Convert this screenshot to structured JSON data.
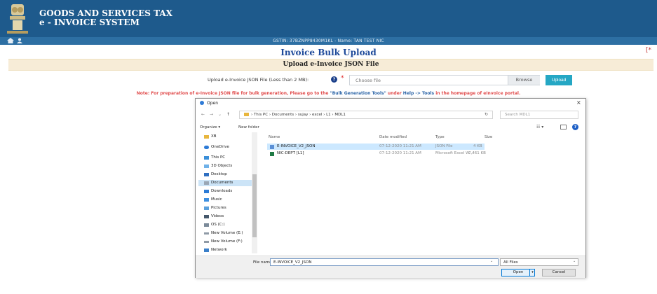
{
  "header": {
    "title_line1": "GOODS AND SERVICES TAX",
    "title_line2": "e - INVOICE SYSTEM"
  },
  "subbar": {
    "gstin_text": "GSTIN: 37BZNPP8430M1KL - Name: TAN TEST NIC"
  },
  "page": {
    "title": "Invoice Bulk Upload",
    "corner_mark": "[*",
    "section_title": "Upload e-Invoice JSON File"
  },
  "upload": {
    "label": "Upload e-Invoice JSON File (Less than 2 MB):",
    "help_glyph": "?",
    "required_mark": "*",
    "choose_placeholder": "Choose file",
    "browse_label": "Browse",
    "upload_label": "Upload"
  },
  "note": {
    "prefix": "Note: For preparation of e-Invoice JSON file for bulk generation, Please go to the ",
    "link": "\"Bulk Generation Tools\"",
    "middle": " under ",
    "help_path": "Help -> Tools",
    "suffix": " in the homepage of eInvoice portal."
  },
  "dialog": {
    "title": "Open",
    "close_glyph": "×",
    "nav_back": "←",
    "nav_forward": "→",
    "nav_recent": "⌄",
    "nav_up": "↑",
    "path": "› This PC › Documents › sujay › excel › L1 › MDL1",
    "refresh_glyph": "↻",
    "search_placeholder": "Search MDL1",
    "toolbar": {
      "organize": "Organize ▾",
      "new_folder": "New folder",
      "view_glyph": "☷ ▾",
      "help_glyph": "?"
    },
    "nav_items": [
      {
        "label": "XB"
      },
      {
        "label": "OneDrive"
      },
      {
        "label": "This PC"
      },
      {
        "label": "3D Objects"
      },
      {
        "label": "Desktop"
      },
      {
        "label": "Documents"
      },
      {
        "label": "Downloads"
      },
      {
        "label": "Music"
      },
      {
        "label": "Pictures"
      },
      {
        "label": "Videos"
      },
      {
        "label": "OS (C:)"
      },
      {
        "label": "New Volume (E:)"
      },
      {
        "label": "New Volume (F:)"
      },
      {
        "label": "Network"
      }
    ],
    "columns": {
      "name": "Name",
      "date": "Date modified",
      "type": "Type",
      "size": "Size"
    },
    "files": [
      {
        "name": "E-INVOICE_V2_JSON",
        "date": "07-12-2020 11:21 AM",
        "type": "JSON File",
        "size": "4 KB"
      },
      {
        "name": "NIC-DEPT [L1]",
        "date": "07-12-2020 11:21 AM",
        "type": "Microsoft Excel W...",
        "size": "7,461 KB"
      }
    ],
    "filename_label": "File name:",
    "filename_value": "E-INVOICE_V2_JSON",
    "filetype_value": "All Files",
    "open_label": "Open",
    "open_dd": "▾",
    "cancel_label": "Cancel",
    "dd_glyph": "⌄"
  }
}
